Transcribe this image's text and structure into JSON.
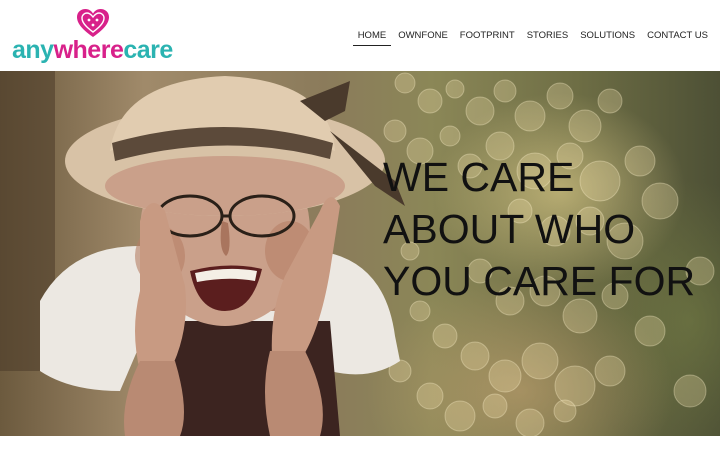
{
  "brand": {
    "logo_part1": "any",
    "logo_part2": "where",
    "logo_part3": "care",
    "logo_icon": "heart-icon",
    "colors": {
      "teal": "#2bb3b1",
      "pink": "#d8218a"
    }
  },
  "nav": {
    "items": [
      {
        "label": "HOME",
        "active": true
      },
      {
        "label": "OWNFONE",
        "active": false
      },
      {
        "label": "FOOTPRINT",
        "active": false
      },
      {
        "label": "STORIES",
        "active": false
      },
      {
        "label": "SOLUTIONS",
        "active": false
      },
      {
        "label": "CONTACT US",
        "active": false
      }
    ]
  },
  "hero": {
    "line1": "WE CARE",
    "line2": "ABOUT WHO",
    "line3": "YOU CARE FOR",
    "image": "smiling-elderly-woman-in-hat-photo"
  }
}
